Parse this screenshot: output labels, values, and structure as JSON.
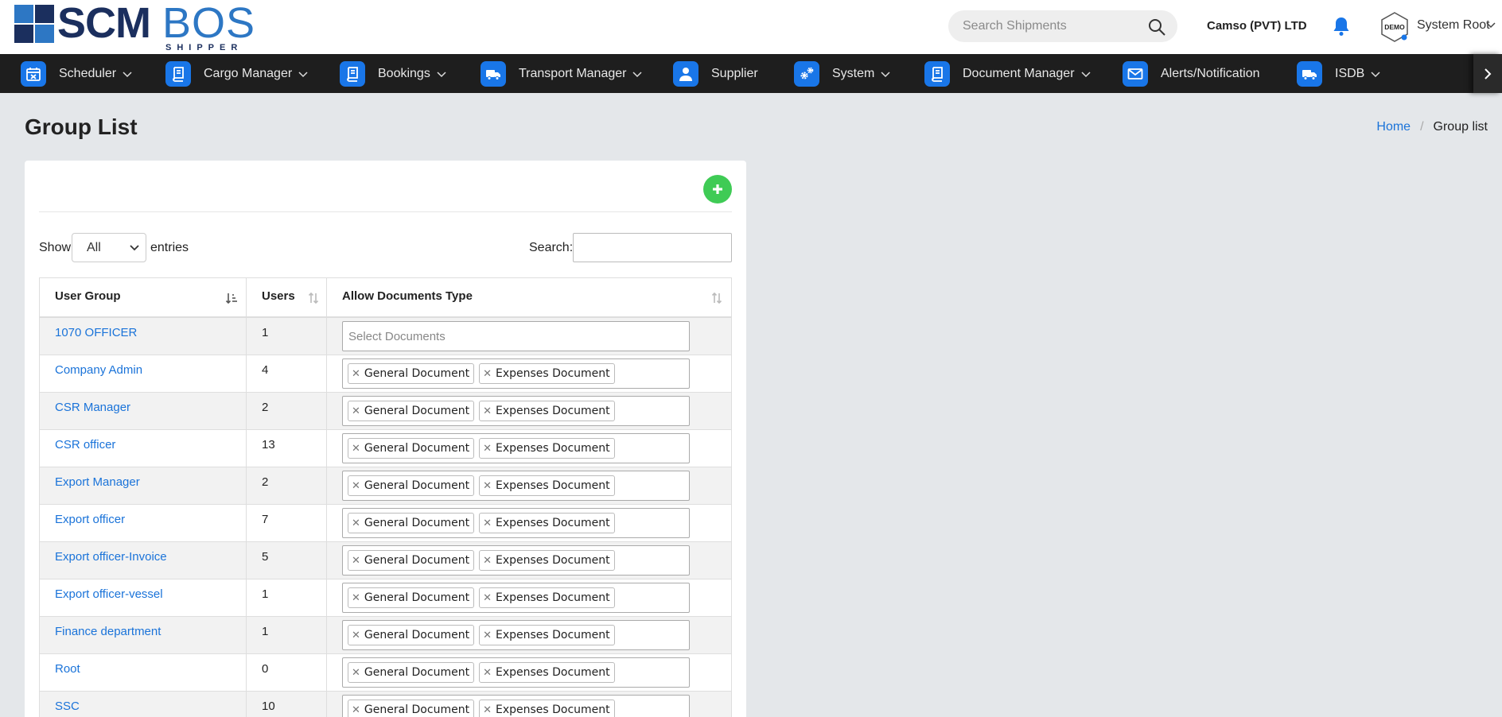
{
  "brand": {
    "logo_primary": "SCM",
    "logo_secondary": "BOS",
    "logo_sub": "SHIPPER",
    "color_dark": "#1b2f5e",
    "color_light": "#2d77c4"
  },
  "header": {
    "search_placeholder": "Search Shipments",
    "company": "Camso (PVT) LTD",
    "avatar_text": "DEMO",
    "user_name": "System Root"
  },
  "nav": {
    "items": [
      {
        "label": "Scheduler",
        "icon": "calendar-icon",
        "has_dropdown": true
      },
      {
        "label": "Cargo Manager",
        "icon": "book-icon",
        "has_dropdown": true
      },
      {
        "label": "Bookings",
        "icon": "book-icon",
        "has_dropdown": true
      },
      {
        "label": "Transport Manager",
        "icon": "truck-icon",
        "has_dropdown": true
      },
      {
        "label": "Supplier",
        "icon": "user-icon",
        "has_dropdown": false
      },
      {
        "label": "System",
        "icon": "gears-icon",
        "has_dropdown": true
      },
      {
        "label": "Document Manager",
        "icon": "book-icon",
        "has_dropdown": true
      },
      {
        "label": "Alerts/Notification",
        "icon": "envelope-icon",
        "has_dropdown": false
      },
      {
        "label": "ISDB",
        "icon": "truck-icon",
        "has_dropdown": true
      }
    ],
    "accent": "#1976e8"
  },
  "page": {
    "title": "Group List",
    "breadcrumb_home": "Home",
    "breadcrumb_separator": "/",
    "breadcrumb_current": "Group list"
  },
  "controls": {
    "show_label": "Show",
    "entries_value": "All",
    "entries_label": "entries",
    "search_label": "Search:",
    "search_value": ""
  },
  "table": {
    "headers": [
      "User Group",
      "Users",
      "Allow Documents Type"
    ],
    "placeholder": "Select Documents",
    "rows": [
      {
        "group": "1070 OFFICER",
        "users": "1",
        "docs": []
      },
      {
        "group": "Company Admin",
        "users": "4",
        "docs": [
          "General Document",
          "Expenses Document"
        ]
      },
      {
        "group": "CSR Manager",
        "users": "2",
        "docs": [
          "General Document",
          "Expenses Document"
        ]
      },
      {
        "group": "CSR officer",
        "users": "13",
        "docs": [
          "General Document",
          "Expenses Document"
        ]
      },
      {
        "group": "Export Manager",
        "users": "2",
        "docs": [
          "General Document",
          "Expenses Document"
        ]
      },
      {
        "group": "Export officer",
        "users": "7",
        "docs": [
          "General Document",
          "Expenses Document"
        ]
      },
      {
        "group": "Export officer-Invoice",
        "users": "5",
        "docs": [
          "General Document",
          "Expenses Document"
        ]
      },
      {
        "group": "Export officer-vessel",
        "users": "1",
        "docs": [
          "General Document",
          "Expenses Document"
        ]
      },
      {
        "group": "Finance department",
        "users": "1",
        "docs": [
          "General Document",
          "Expenses Document"
        ]
      },
      {
        "group": "Root",
        "users": "0",
        "docs": [
          "General Document",
          "Expenses Document"
        ]
      },
      {
        "group": "SSC",
        "users": "10",
        "docs": [
          "General Document",
          "Expenses Document"
        ]
      }
    ]
  }
}
